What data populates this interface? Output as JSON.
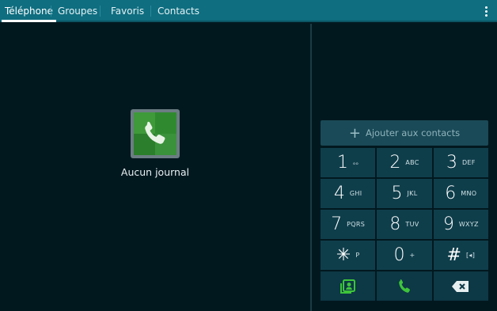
{
  "tabs": [
    {
      "label": "Téléphone",
      "active": true
    },
    {
      "label": "Groupes",
      "active": false
    },
    {
      "label": "Favoris",
      "active": false
    },
    {
      "label": "Contacts",
      "active": false
    }
  ],
  "menu": {
    "icon": "more-vert-icon"
  },
  "log": {
    "empty_icon": "phone-log-icon",
    "empty_label": "Aucun journal"
  },
  "dialer": {
    "add_contacts_label": "Ajouter aux contacts",
    "keys": [
      {
        "digit": "1",
        "letters": "ₒₒ"
      },
      {
        "digit": "2",
        "letters": "ABC"
      },
      {
        "digit": "3",
        "letters": "DEF"
      },
      {
        "digit": "4",
        "letters": "GHI"
      },
      {
        "digit": "5",
        "letters": "JKL"
      },
      {
        "digit": "6",
        "letters": "MNO"
      },
      {
        "digit": "7",
        "letters": "PQRS"
      },
      {
        "digit": "8",
        "letters": "TUV"
      },
      {
        "digit": "9",
        "letters": "WXYZ"
      },
      {
        "digit": "✳",
        "letters": "P"
      },
      {
        "digit": "0",
        "letters": "+"
      },
      {
        "digit": "#",
        "letters": "[◂]"
      }
    ],
    "actions": [
      {
        "icon": "contacts-icon"
      },
      {
        "icon": "call-icon"
      },
      {
        "icon": "backspace-icon"
      }
    ],
    "accent": "#3ec43a"
  }
}
